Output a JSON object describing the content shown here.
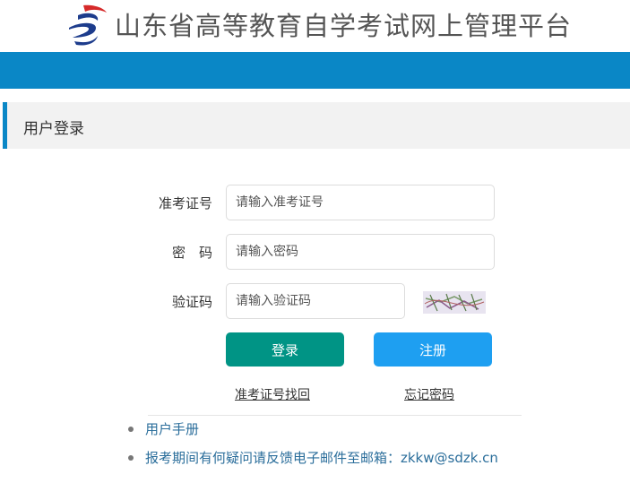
{
  "header": {
    "title": "山东省高等教育自学考试网上管理平台"
  },
  "panel": {
    "title": "用户登录"
  },
  "form": {
    "exam_id_label": "准考证号",
    "exam_id_placeholder": "请输入准考证号",
    "password_label": "密　码",
    "password_placeholder": "请输入密码",
    "captcha_label": "验证码",
    "captcha_placeholder": "请输入验证码",
    "login_button": "登录",
    "register_button": "注册",
    "recover_id_link": "准考证号找回",
    "forgot_password_link": "忘记密码"
  },
  "notes": [
    "用户手册",
    "报考期间有何疑问请反馈电子邮件至邮箱：zkkw@sdzk.cn"
  ],
  "colors": {
    "brand_blue": "#0a87c6",
    "login_green": "#009485",
    "register_blue": "#1e9ff1",
    "logo_red": "#d62a2a",
    "logo_navy": "#1d3c8c"
  }
}
